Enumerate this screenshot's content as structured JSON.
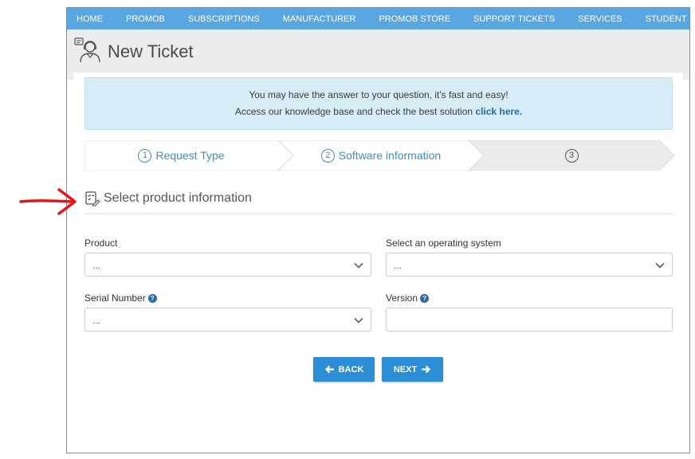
{
  "nav": {
    "items": [
      "HOME",
      "PROMOB",
      "SUBSCRIPTIONS",
      "MANUFACTURER",
      "PROMOB STORE",
      "SUPPORT TICKETS",
      "SERVICES",
      "STUDENT"
    ]
  },
  "header": {
    "title": "New Ticket",
    "icon": "support-agent-icon"
  },
  "info": {
    "line1": "You may have the answer to your question, it's fast and easy!",
    "line2_prefix": "Access our knowledge base and check the best solution",
    "line2_link": "click here."
  },
  "steps": [
    {
      "number": "1",
      "label": "Request Type"
    },
    {
      "number": "2",
      "label": "Software information"
    },
    {
      "number": "3",
      "label": ""
    }
  ],
  "section": {
    "title": "Select product information",
    "icon": "checklist-edit-icon"
  },
  "form": {
    "product": {
      "label": "Product",
      "value": "..."
    },
    "operating_system": {
      "label": "Select an operating system",
      "value": "..."
    },
    "serial_number": {
      "label": "Serial Number",
      "value": "..."
    },
    "version": {
      "label": "Version",
      "value": ""
    }
  },
  "buttons": {
    "back": "BACK",
    "next": "NEXT"
  },
  "colors": {
    "nav_bg": "#5aa6e0",
    "accent": "#2c8ed6",
    "info_bg": "#d6edf7",
    "annotation_arrow": "#e8141b"
  }
}
